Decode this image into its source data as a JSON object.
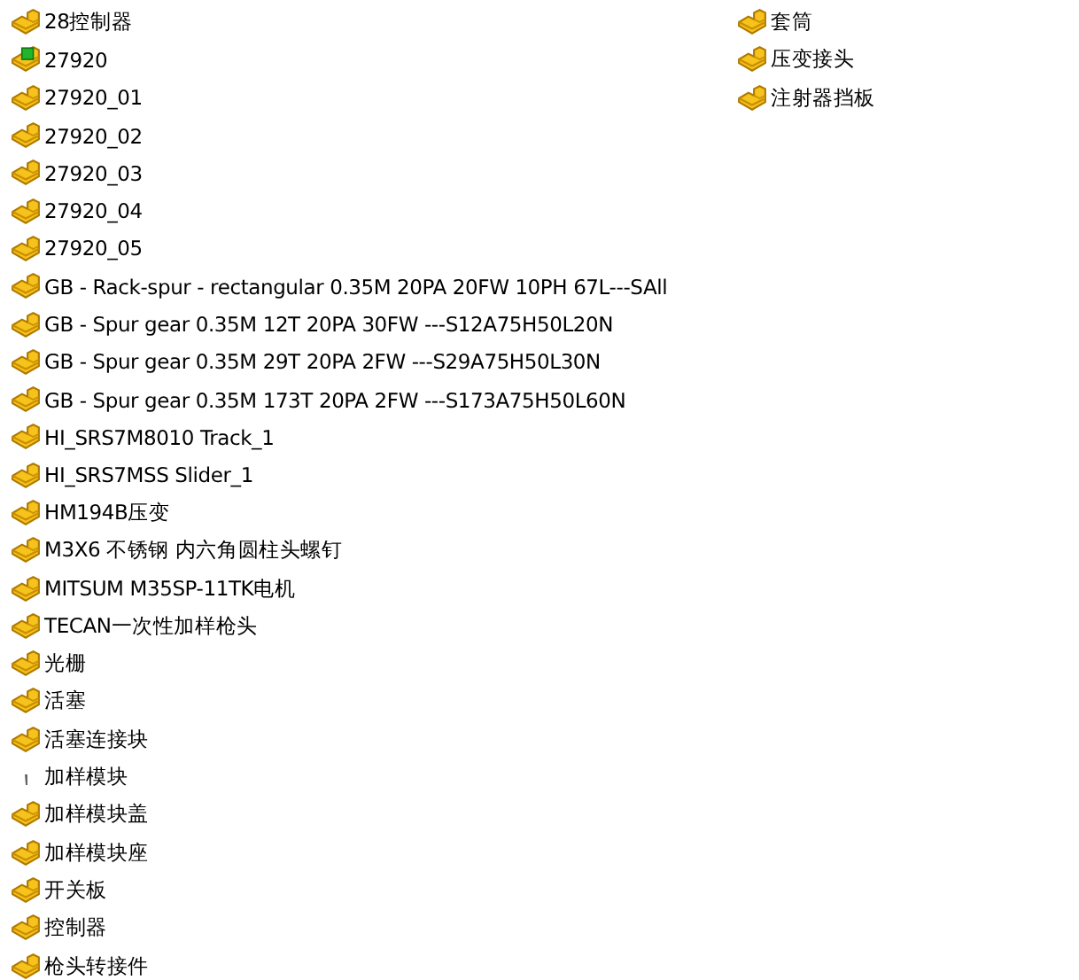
{
  "columns": [
    {
      "items": [
        {
          "name": "28控制器",
          "kind": "part"
        },
        {
          "name": "27920",
          "kind": "part-marked"
        },
        {
          "name": "27920_01",
          "kind": "part"
        },
        {
          "name": "27920_02",
          "kind": "part"
        },
        {
          "name": "27920_03",
          "kind": "part"
        },
        {
          "name": "27920_04",
          "kind": "part"
        },
        {
          "name": "27920_05",
          "kind": "part"
        },
        {
          "name": "GB - Rack-spur - rectangular 0.35M 20PA 20FW 10PH 67L---SAll",
          "kind": "part"
        },
        {
          "name": "GB - Spur gear 0.35M 12T 20PA 30FW ---S12A75H50L20N",
          "kind": "part"
        },
        {
          "name": "GB - Spur gear 0.35M 29T 20PA 2FW ---S29A75H50L30N",
          "kind": "part"
        },
        {
          "name": "GB - Spur gear 0.35M 173T 20PA 2FW ---S173A75H50L60N",
          "kind": "part"
        },
        {
          "name": "HI_SRS7M8010 Track_1",
          "kind": "part"
        },
        {
          "name": "HI_SRS7MSS Slider_1",
          "kind": "part"
        },
        {
          "name": "HM194B压变",
          "kind": "part"
        },
        {
          "name": "M3X6 不锈钢 内六角圆柱头螺钉",
          "kind": "part"
        },
        {
          "name": "MITSUM M35SP-11TK电机",
          "kind": "part"
        },
        {
          "name": "TECAN一次性加样枪头",
          "kind": "part"
        },
        {
          "name": "光栅",
          "kind": "part"
        },
        {
          "name": "活塞",
          "kind": "part"
        },
        {
          "name": "活塞连接块",
          "kind": "part"
        },
        {
          "name": "加样模块",
          "kind": "generic"
        },
        {
          "name": "加样模块盖",
          "kind": "part"
        },
        {
          "name": "加样模块座",
          "kind": "part"
        },
        {
          "name": "开关板",
          "kind": "part"
        },
        {
          "name": "控制器",
          "kind": "part"
        },
        {
          "name": "枪头转接件",
          "kind": "part"
        }
      ]
    },
    {
      "items": [
        {
          "name": "套筒",
          "kind": "part"
        },
        {
          "name": "压变接头",
          "kind": "part"
        },
        {
          "name": "注射器挡板",
          "kind": "part"
        }
      ]
    }
  ]
}
